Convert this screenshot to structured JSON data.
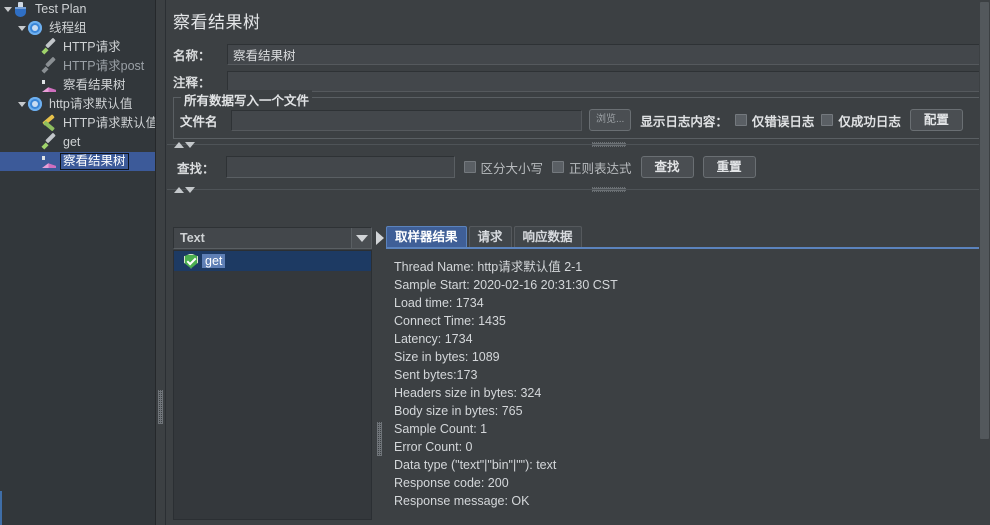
{
  "tree": {
    "items": [
      {
        "label": "Test Plan",
        "icon": "flask-icon",
        "indent": 0,
        "twisty": true,
        "selected": false,
        "dim": false
      },
      {
        "label": "线程组",
        "icon": "gear-icon",
        "indent": 1,
        "twisty": true,
        "selected": false,
        "dim": false
      },
      {
        "label": "HTTP请求",
        "icon": "pencil-icon",
        "indent": 2,
        "twisty": false,
        "selected": false,
        "dim": false
      },
      {
        "label": "HTTP请求post",
        "icon": "pencil-gray-icon",
        "indent": 2,
        "twisty": false,
        "selected": false,
        "dim": true
      },
      {
        "label": "察看结果树",
        "icon": "chart-icon",
        "indent": 2,
        "twisty": false,
        "selected": false,
        "dim": false
      },
      {
        "label": "http请求默认值",
        "icon": "gear-icon",
        "indent": 1,
        "twisty": true,
        "selected": false,
        "dim": false
      },
      {
        "label": "HTTP请求默认值",
        "icon": "wrench-icon",
        "indent": 2,
        "twisty": false,
        "selected": false,
        "dim": false
      },
      {
        "label": "get",
        "icon": "pencil-icon",
        "indent": 2,
        "twisty": false,
        "selected": false,
        "dim": false
      },
      {
        "label": "察看结果树",
        "icon": "chart-icon",
        "indent": 2,
        "twisty": false,
        "selected": true,
        "dim": false
      }
    ]
  },
  "page": {
    "title": "察看结果树",
    "name_label": "名称：",
    "name_value": "察看结果树",
    "comment_label": "注释：",
    "comment_value": "",
    "comment_placeholder": ""
  },
  "filegroup": {
    "legend": "所有数据写入一个文件",
    "filename_label": "文件名",
    "filename_value": "",
    "browse_button": "浏览...",
    "log_display_label": "显示日志内容：",
    "errors_only": "仅错误日志",
    "successes_only": "仅成功日志",
    "configure_button": "配置"
  },
  "search": {
    "label": "查找：",
    "value": "",
    "placeholder": "",
    "case_sensitive": "区分大小写",
    "regex": "正则表达式",
    "find_button": "查找",
    "reset_button": "重置"
  },
  "results": {
    "renderer_selected": "Text",
    "items": [
      {
        "label": "get",
        "status": "success"
      }
    ],
    "tabs": [
      {
        "label": "取样器结果",
        "active": true
      },
      {
        "label": "请求",
        "active": false
      },
      {
        "label": "响应数据",
        "active": false
      }
    ],
    "detail_lines": [
      "Thread Name: http请求默认值 2-1",
      "Sample Start: 2020-02-16 20:31:30 CST",
      "Load time: 1734",
      "Connect Time: 1435",
      "Latency: 1734",
      "Size in bytes: 1089",
      "Sent bytes:173",
      "Headers size in bytes: 324",
      "Body size in bytes: 765",
      "Sample Count: 1",
      "Error Count: 0",
      "Data type (\"text\"|\"bin\"|\"\"): text",
      "Response code: 200",
      "Response message: OK"
    ]
  },
  "colors": {
    "background": "#3c4043",
    "panel": "#32373b",
    "selection_blue": "#3c5a99",
    "tab_active": "#3f5f97",
    "accent_underline": "#5b83bd",
    "success_green": "#4caf50"
  }
}
